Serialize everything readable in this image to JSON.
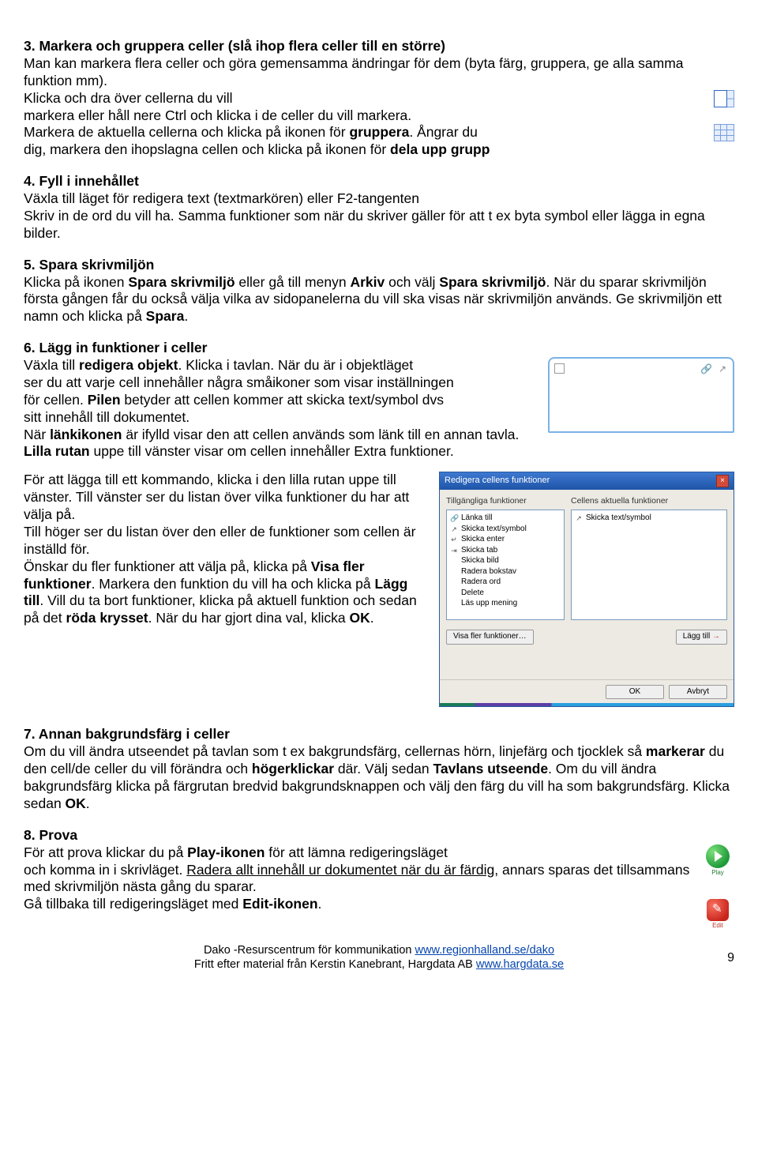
{
  "sec3": {
    "heading": "3. Markera och gruppera celler (slå ihop flera celler till en större)",
    "p1": "Man kan markera flera celler och göra gemensamma ändringar för dem (byta färg, gruppera, ge alla samma funktion mm).",
    "p2a": "Klicka och dra över cellerna du vill",
    "p2b": "markera eller håll nere Ctrl och klicka i de celler du vill markera.",
    "p2c_pre": "Markera de aktuella cellerna och klicka på ikonen för ",
    "p2c_b": "gruppera",
    "p2c_post": ". Ångrar du",
    "p3_pre": "dig, markera den ihopslagna cellen och klicka på ikonen för ",
    "p3_b": "dela upp grupp"
  },
  "sec4": {
    "heading": "4. Fyll i innehållet",
    "p1": "Växla till läget för redigera text (textmarkören) eller F2-tangenten",
    "p2": "Skriv in de ord du vill ha. Samma funktioner som när du skriver gäller för att t ex byta symbol eller lägga in egna bilder."
  },
  "sec5": {
    "heading": "5. Spara skrivmiljön",
    "p1_a": "Klicka på ikonen ",
    "p1_b1": "Spara skrivmiljö",
    "p1_c": " eller gå till menyn ",
    "p1_b2": "Arkiv",
    "p1_d": " och välj ",
    "p1_b3": "Spara skrivmiljö",
    "p1_e": ". När du sparar skrivmiljön första gången får du också välja vilka av sidopanelerna du vill ska visas när skrivmiljön används. Ge skrivmiljön ett namn och klicka på ",
    "p1_b4": "Spara",
    "p1_f": "."
  },
  "sec6": {
    "heading": "6. Lägg in funktioner i celler",
    "l1_a": "Växla till ",
    "l1_b": "redigera objekt",
    "l1_c": ". Klicka i tavlan. När du är i objektläget",
    "l2": "ser du att varje cell innehåller några småikoner som visar inställningen",
    "l3_a": "för cellen. ",
    "l3_b": "Pilen",
    "l3_c": " betyder att cellen kommer att skicka text/symbol dvs",
    "l4": "sitt innehåll till dokumentet.",
    "l5_a": "När ",
    "l5_b": "länkikonen",
    "l5_c": " är ifylld visar den att cellen används som länk till en annan tavla.",
    "l6_a": "",
    "l6_b": "Lilla rutan",
    "l6_c": " uppe till vänster visar om cellen innehåller Extra funktioner.",
    "l7": "För att lägga till ett kommando, klicka i den lilla rutan uppe till vänster. Till vänster ser du listan över vilka funktioner du har att välja på.",
    "l8": "Till höger ser du listan över den eller de funktioner som cellen är inställd för.",
    "l9_a": "Önskar du fler funktioner att välja på, klicka på ",
    "l9_b": "Visa fler funktioner",
    "l9_c": ". Markera den funktion du vill ha och klicka på ",
    "l9_d": "Lägg till",
    "l9_e": ". Vill du ta bort funktioner, klicka på aktuell funktion och sedan på det ",
    "l9_f": "röda krysset",
    "l9_g": ". När du har gjort dina val, klicka ",
    "l9_h": "OK",
    "l9_i": "."
  },
  "dialog": {
    "title": "Redigera cellens funktioner",
    "left_label": "Tillgängliga funktioner",
    "right_label": "Cellens aktuella funktioner",
    "left_items": [
      "Länka till",
      "Skicka text/symbol",
      "Skicka enter",
      "Skicka tab",
      "Skicka bild",
      "Radera bokstav",
      "Radera ord",
      "Delete",
      "Läs upp mening"
    ],
    "right_items": [
      "Skicka text/symbol"
    ],
    "btn_more": "Visa fler funktioner…",
    "btn_add": "Lägg till",
    "btn_ok": "OK",
    "btn_cancel": "Avbryt"
  },
  "sec7": {
    "heading": "7. Annan bakgrundsfärg i celler",
    "p1": "Om du vill ändra utseendet på tavlan som t ex bakgrundsfärg, cellernas hörn, linjefärg och tjocklek så ",
    "p1_b1": "markerar",
    "p1_c": " du den cell/de celler du vill förändra och ",
    "p1_b2": "högerklickar",
    "p1_d": " där. Välj sedan ",
    "p1_b3": "Tavlans utseende",
    "p1_e": ". Om du vill ändra bakgrundsfärg klicka på färgrutan bredvid bakgrundsknappen och välj den färg du vill ha som bakgrundsfärg. Klicka sedan ",
    "p1_b4": "OK",
    "p1_f": "."
  },
  "sec8": {
    "heading": "8. Prova",
    "l1_a": "För att prova klickar du på ",
    "l1_b": "Play-ikonen",
    "l1_c": " för att lämna redigeringsläget",
    "l2": "och komma in i skrivläget. ",
    "l2_u": "Radera allt innehåll ur dokumentet när du är färdig,",
    "l2_c": " annars sparas det tillsammans med skrivmiljön nästa gång du sparar.",
    "l4_a": "Gå tillbaka till redigeringsläget med ",
    "l4_b": "Edit-ikonen",
    "l4_c": "."
  },
  "icons": {
    "play_label": "Play",
    "edit_label": "Edit"
  },
  "footer": {
    "line1_a": "Dako -Resurscentrum för kommunikation ",
    "line1_link": "www.regionhalland.se/dako",
    "line2_a": "Fritt efter material från Kerstin Kanebrant, Hargdata AB ",
    "line2_link": "www.hargdata.se",
    "page": "9"
  }
}
